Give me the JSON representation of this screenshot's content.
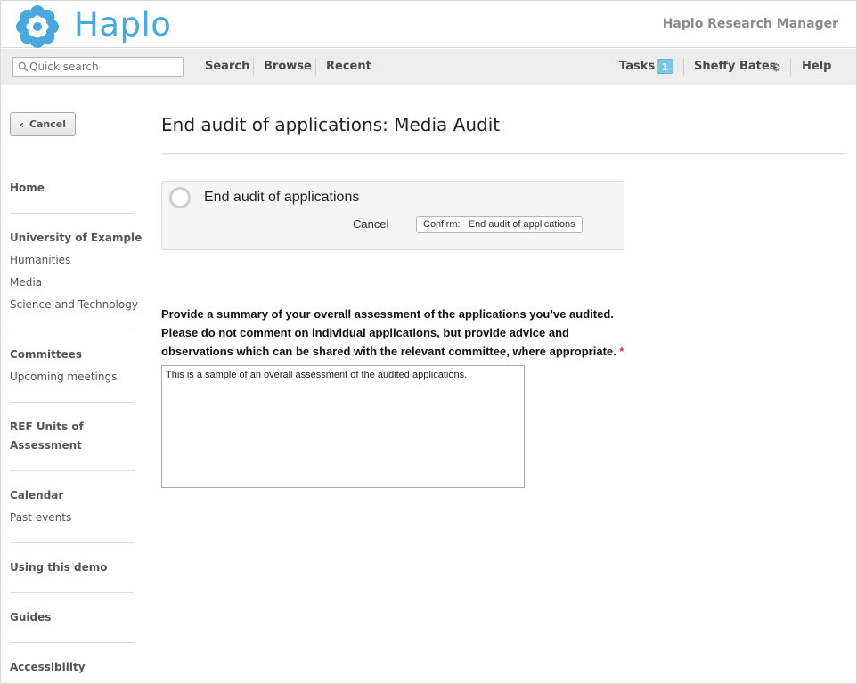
{
  "header": {
    "brand": "Haplo",
    "product": "Haplo Research Manager"
  },
  "navbar": {
    "search_placeholder": "Quick search",
    "items": [
      "Search",
      "Browse",
      "Recent"
    ],
    "tasks_label": "Tasks",
    "tasks_count": "1",
    "user_name": "Sheffy Bates",
    "help_label": "Help"
  },
  "sidebar": {
    "cancel_label": "Cancel",
    "home": "Home",
    "university": "University of Example",
    "university_links": [
      "Humanities",
      "Media",
      "Science and Technology"
    ],
    "committees": "Committees",
    "committees_links": [
      "Upcoming meetings"
    ],
    "ref_line1": "REF Units of",
    "ref_line2": "Assessment",
    "calendar": "Calendar",
    "calendar_links": [
      "Past events"
    ],
    "using_demo": "Using this demo",
    "guides": "Guides",
    "accessibility": "Accessibility"
  },
  "main": {
    "title": "End audit of applications: Media Audit",
    "confirm": {
      "label": "End audit of applications",
      "cancel": "Cancel",
      "button": "Confirm:   End audit of applications"
    },
    "question_lines": [
      "Provide a summary of your overall assessment of the applications you’ve audited.",
      "Please do not comment on individual applications, but provide advice and",
      "observations which can be shared with the relevant committee, where appropriate."
    ],
    "required_marker": "*",
    "answer": "This is a sample of an overall assessment of the audited applications."
  },
  "colors": {
    "brand": "#4aa8de",
    "badge": "#7ec4e8",
    "required": "#d23a3a"
  },
  "icons": {
    "logo": "haplo-flower-logo",
    "search": "magnifier-icon",
    "back": "chevron-left-icon",
    "user_menu": "gear-icon"
  }
}
